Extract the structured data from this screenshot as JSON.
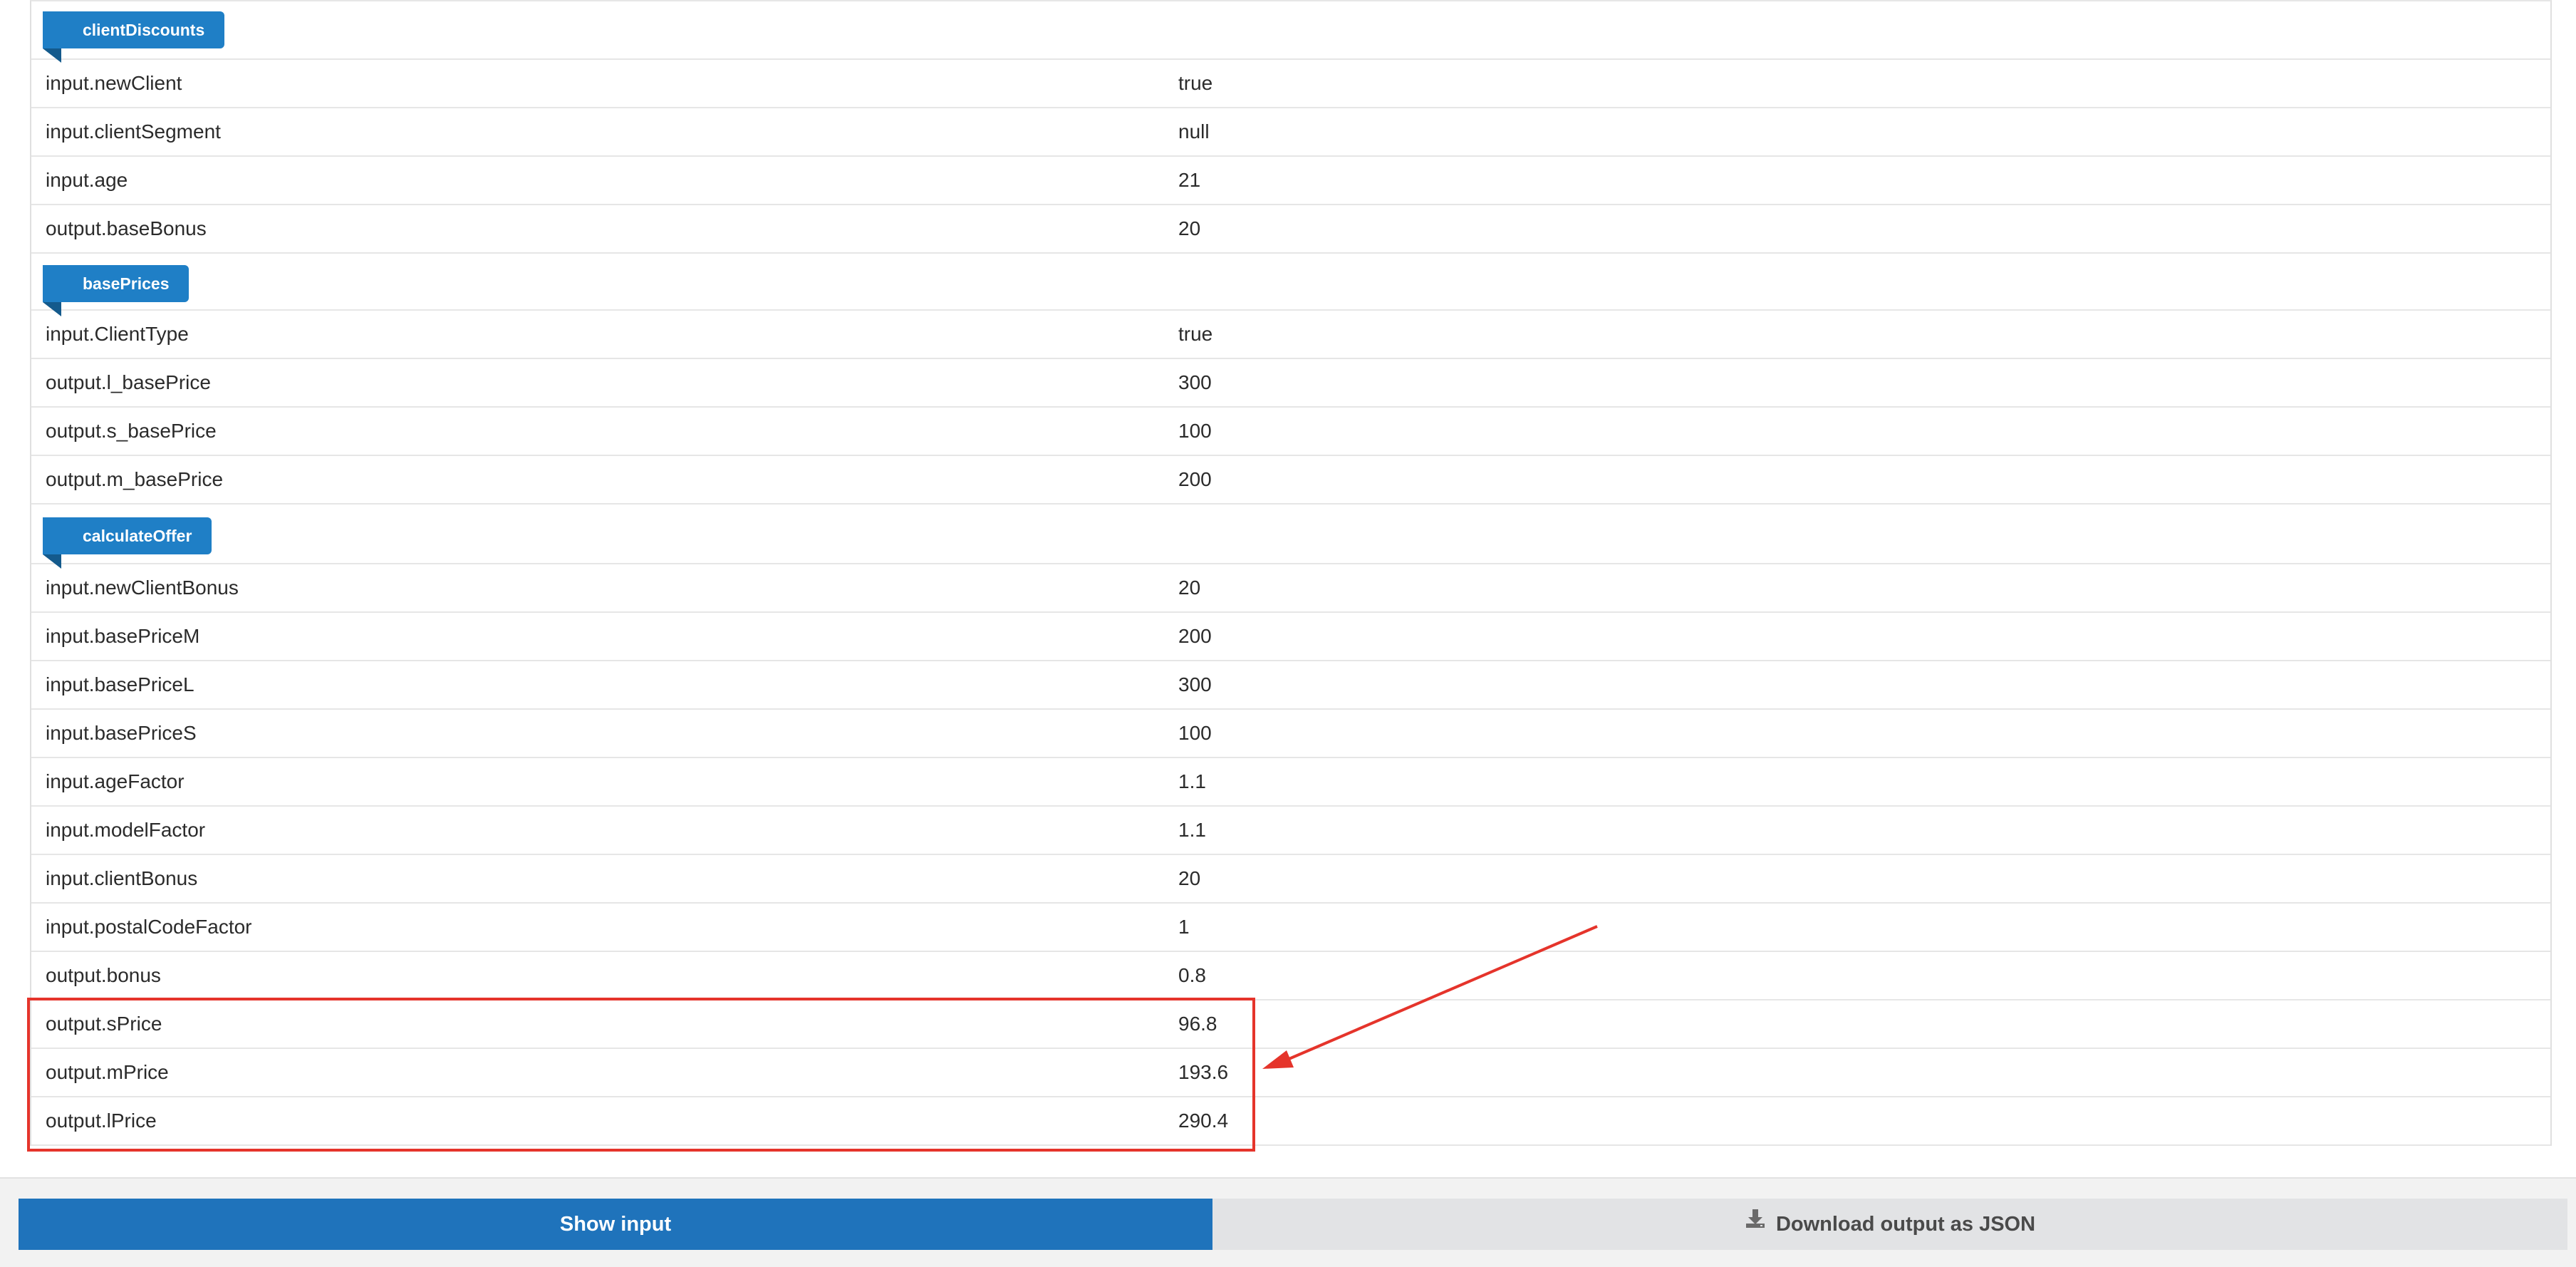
{
  "sections": [
    {
      "title": "clientDiscounts",
      "rows": [
        {
          "key": "input.newClient",
          "value": "true"
        },
        {
          "key": "input.clientSegment",
          "value": "null"
        },
        {
          "key": "input.age",
          "value": "21"
        },
        {
          "key": "output.baseBonus",
          "value": "20"
        }
      ]
    },
    {
      "title": "basePrices",
      "rows": [
        {
          "key": "input.ClientType",
          "value": "true"
        },
        {
          "key": "output.l_basePrice",
          "value": "300"
        },
        {
          "key": "output.s_basePrice",
          "value": "100"
        },
        {
          "key": "output.m_basePrice",
          "value": "200"
        }
      ]
    },
    {
      "title": "calculateOffer",
      "rows": [
        {
          "key": "input.newClientBonus",
          "value": "20"
        },
        {
          "key": "input.basePriceM",
          "value": "200"
        },
        {
          "key": "input.basePriceL",
          "value": "300"
        },
        {
          "key": "input.basePriceS",
          "value": "100"
        },
        {
          "key": "input.ageFactor",
          "value": "1.1"
        },
        {
          "key": "input.modelFactor",
          "value": "1.1"
        },
        {
          "key": "input.clientBonus",
          "value": "20"
        },
        {
          "key": "input.postalCodeFactor",
          "value": "1"
        },
        {
          "key": "output.bonus",
          "value": "0.8"
        },
        {
          "key": "output.sPrice",
          "value": "96.8"
        },
        {
          "key": "output.mPrice",
          "value": "193.6"
        },
        {
          "key": "output.lPrice",
          "value": "290.4"
        }
      ]
    }
  ],
  "footer": {
    "show_input_label": "Show input",
    "download_label": "Download output as JSON",
    "download_icon": "download-icon"
  },
  "annotation": {
    "color": "#e5342b"
  }
}
